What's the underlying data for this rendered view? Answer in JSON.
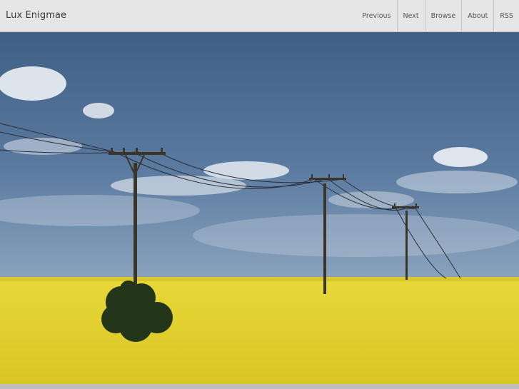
{
  "header": {
    "site_title": "Lux Enigmae",
    "nav": [
      {
        "label": "Previous"
      },
      {
        "label": "Next"
      },
      {
        "label": "Browse"
      },
      {
        "label": "About"
      },
      {
        "label": "RSS"
      }
    ]
  },
  "photo": {
    "subject": "power-lines-over-rapeseed-field"
  },
  "colors": {
    "header_bg": "#e6e6e6",
    "sky_top": "#3f5f85",
    "field": "#e6d428"
  }
}
